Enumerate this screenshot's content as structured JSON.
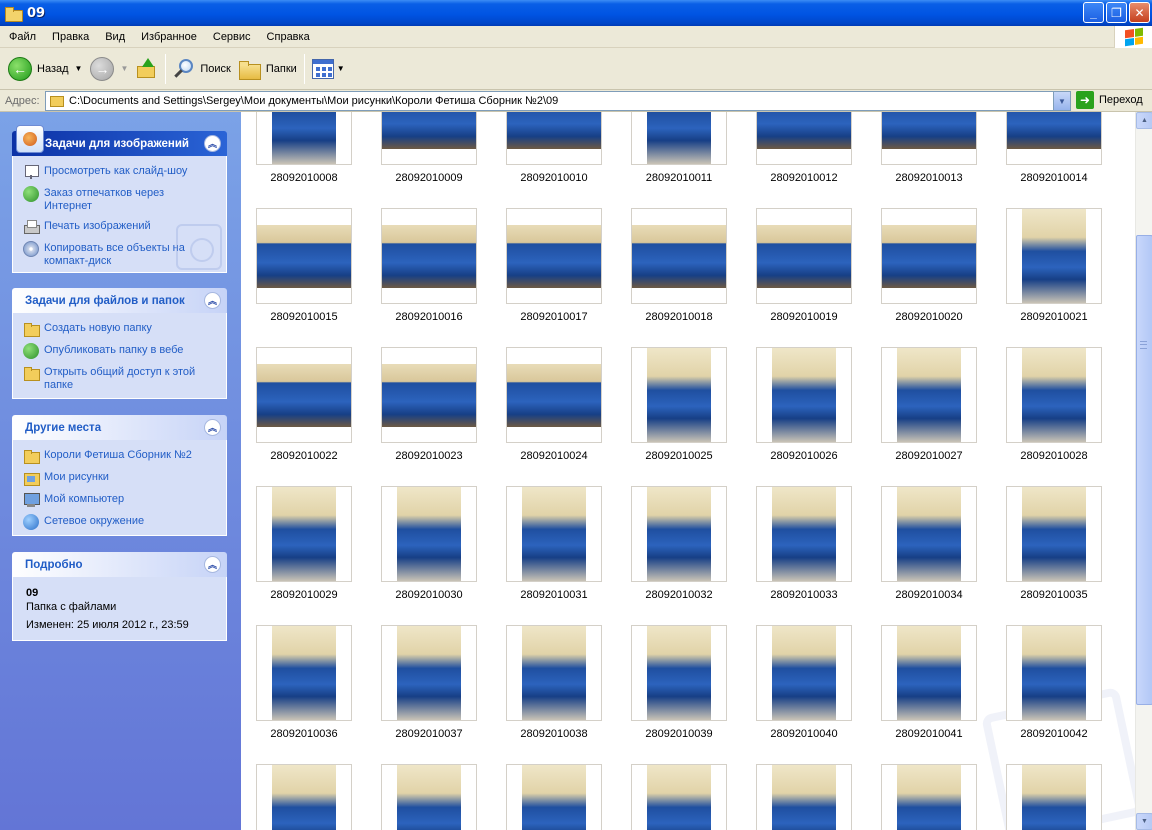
{
  "window": {
    "title": "09"
  },
  "menu": [
    "Файл",
    "Правка",
    "Вид",
    "Избранное",
    "Сервис",
    "Справка"
  ],
  "toolbar": {
    "back_label": "Назад",
    "search_label": "Поиск",
    "folders_label": "Папки"
  },
  "address": {
    "label": "Адрес:",
    "path": "C:\\Documents and Settings\\Sergey\\Мои документы\\Мои рисунки\\Короли Фетиша Сборник №2\\09",
    "go_label": "Переход"
  },
  "taskpane": {
    "image_tasks": {
      "title": "Задачи для изображений",
      "items": [
        {
          "label": "Просмотреть как слайд-шоу",
          "icon": "slideshow-icon"
        },
        {
          "label": "Заказ отпечатков через Интернет",
          "icon": "globe-icon"
        },
        {
          "label": "Печать изображений",
          "icon": "printer-icon"
        },
        {
          "label": "Копировать все объекты на компакт-диск",
          "icon": "cd-icon"
        }
      ]
    },
    "file_tasks": {
      "title": "Задачи для файлов и папок",
      "items": [
        {
          "label": "Создать новую папку",
          "icon": "new-folder-icon"
        },
        {
          "label": "Опубликовать папку в вебе",
          "icon": "publish-web-icon"
        },
        {
          "label": "Открыть общий доступ к этой папке",
          "icon": "share-folder-icon"
        }
      ]
    },
    "other_places": {
      "title": "Другие места",
      "items": [
        {
          "label": "Короли Фетиша Сборник №2",
          "icon": "folder-icon"
        },
        {
          "label": "Мои рисунки",
          "icon": "my-pictures-icon"
        },
        {
          "label": "Мой компьютер",
          "icon": "my-computer-icon"
        },
        {
          "label": "Сетевое окружение",
          "icon": "network-icon"
        }
      ]
    },
    "details": {
      "title": "Подробно",
      "name": "09",
      "type": "Папка с файлами",
      "modified": "Изменен: 25 июля 2012 г., 23:59"
    }
  },
  "files": [
    {
      "name": "28092010008",
      "orient": "p"
    },
    {
      "name": "28092010009",
      "orient": "l"
    },
    {
      "name": "28092010010",
      "orient": "l"
    },
    {
      "name": "28092010011",
      "orient": "p"
    },
    {
      "name": "28092010012",
      "orient": "l"
    },
    {
      "name": "28092010013",
      "orient": "l"
    },
    {
      "name": "28092010014",
      "orient": "l"
    },
    {
      "name": "28092010015",
      "orient": "l"
    },
    {
      "name": "28092010016",
      "orient": "l"
    },
    {
      "name": "28092010017",
      "orient": "l"
    },
    {
      "name": "28092010018",
      "orient": "l"
    },
    {
      "name": "28092010019",
      "orient": "l"
    },
    {
      "name": "28092010020",
      "orient": "l"
    },
    {
      "name": "28092010021",
      "orient": "p"
    },
    {
      "name": "28092010022",
      "orient": "l"
    },
    {
      "name": "28092010023",
      "orient": "l"
    },
    {
      "name": "28092010024",
      "orient": "l"
    },
    {
      "name": "28092010025",
      "orient": "p"
    },
    {
      "name": "28092010026",
      "orient": "p"
    },
    {
      "name": "28092010027",
      "orient": "p"
    },
    {
      "name": "28092010028",
      "orient": "p"
    },
    {
      "name": "28092010029",
      "orient": "p"
    },
    {
      "name": "28092010030",
      "orient": "p"
    },
    {
      "name": "28092010031",
      "orient": "p"
    },
    {
      "name": "28092010032",
      "orient": "p"
    },
    {
      "name": "28092010033",
      "orient": "p"
    },
    {
      "name": "28092010034",
      "orient": "p"
    },
    {
      "name": "28092010035",
      "orient": "p"
    },
    {
      "name": "28092010036",
      "orient": "p"
    },
    {
      "name": "28092010037",
      "orient": "p"
    },
    {
      "name": "28092010038",
      "orient": "p"
    },
    {
      "name": "28092010039",
      "orient": "p"
    },
    {
      "name": "28092010040",
      "orient": "p"
    },
    {
      "name": "28092010041",
      "orient": "p"
    },
    {
      "name": "28092010042",
      "orient": "p"
    },
    {
      "name": "",
      "orient": "p"
    },
    {
      "name": "",
      "orient": "p"
    },
    {
      "name": "",
      "orient": "p"
    },
    {
      "name": "",
      "orient": "p"
    },
    {
      "name": "",
      "orient": "p"
    },
    {
      "name": "",
      "orient": "p"
    },
    {
      "name": "",
      "orient": "p"
    }
  ],
  "colors": {
    "titlebar": "#0054e3",
    "taskpane_top": "#7ba2e7",
    "taskpane_bottom": "#6375d6",
    "link": "#215dc6",
    "sofa_blue": "#1f4fa0"
  }
}
